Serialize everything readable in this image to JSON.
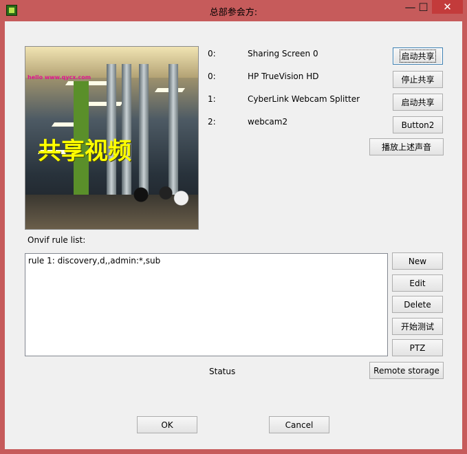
{
  "window": {
    "title": "总部参会方:",
    "controls": {
      "minimize": "—",
      "maximize": "☐",
      "close": "✕"
    }
  },
  "video": {
    "watermark": "hello www.qycx.com",
    "caption": "共享视频"
  },
  "devices": [
    {
      "index": "0:",
      "name": "Sharing Screen 0"
    },
    {
      "index": "0:",
      "name": "HP TrueVision HD"
    },
    {
      "index": "1:",
      "name": "CyberLink Webcam Splitter"
    },
    {
      "index": "2:",
      "name": "webcam2"
    }
  ],
  "side_buttons": {
    "start_share": "启动共享",
    "stop_share": "停止共享",
    "start_share2": "启动共享",
    "button2": "Button2",
    "play_audio": "播放上述声音"
  },
  "onvif": {
    "label": "Onvif rule list:",
    "rules": [
      "rule 1: discovery,d,,admin:*,sub"
    ]
  },
  "onvif_buttons": {
    "new": "New",
    "edit": "Edit",
    "delete": "Delete",
    "start_test": "开始测试",
    "ptz": "PTZ",
    "remote_storage": "Remote storage"
  },
  "status": "Status",
  "footer": {
    "ok": "OK",
    "cancel": "Cancel"
  }
}
